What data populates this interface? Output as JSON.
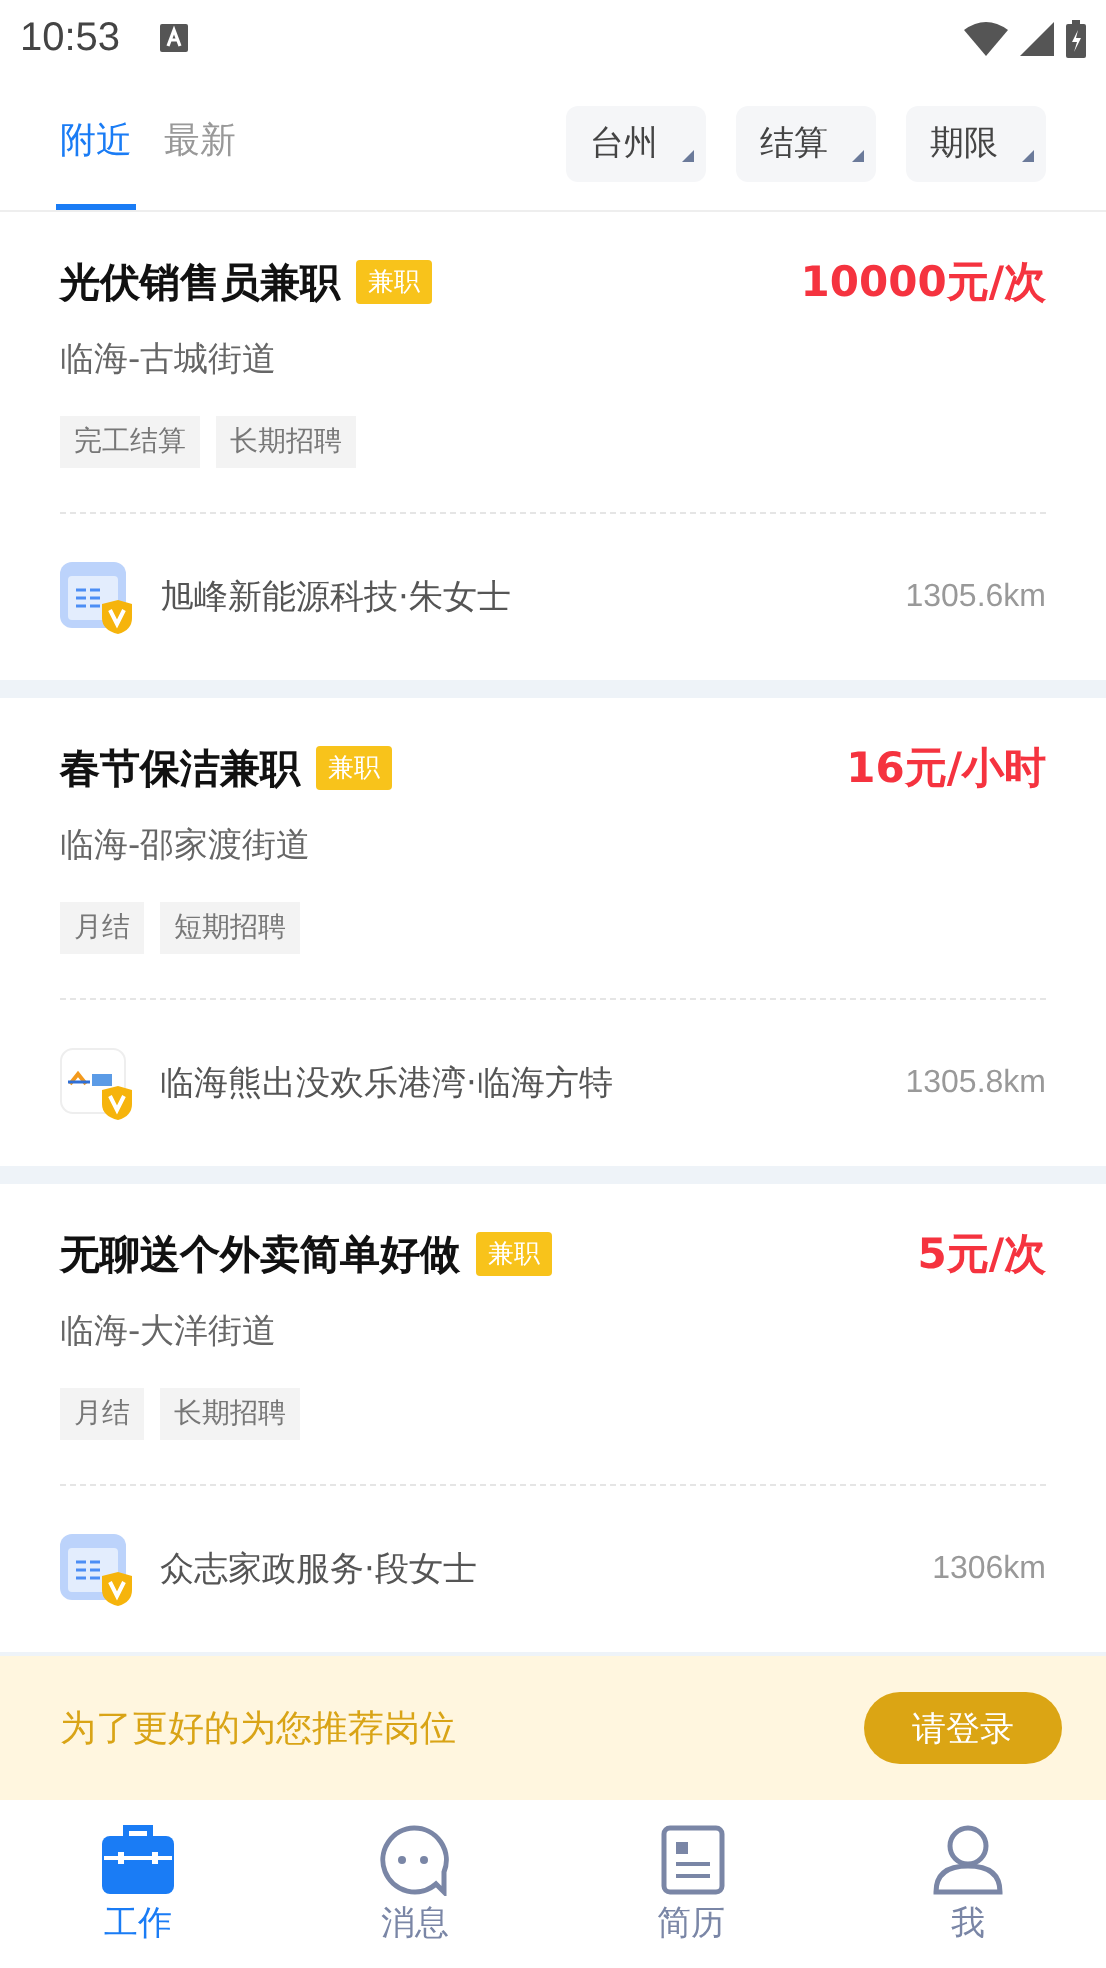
{
  "status_bar": {
    "time": "10:53"
  },
  "tabs": [
    {
      "label": "附近",
      "selected": true
    },
    {
      "label": "最新",
      "selected": false
    }
  ],
  "filters": [
    {
      "label": "台州"
    },
    {
      "label": "结算"
    },
    {
      "label": "期限"
    }
  ],
  "jobs": [
    {
      "title": "光伏销售员兼职",
      "badge": "兼职",
      "pay": "10000元/次",
      "location": "临海-古城街道",
      "tags": [
        "完工结算",
        "长期招聘"
      ],
      "company": "旭峰新能源科技·朱女士",
      "kind": "document",
      "distance": "1305.6km"
    },
    {
      "title": "春节保洁兼职",
      "badge": "兼职",
      "pay": "16元/小时",
      "location": "临海-邵家渡街道",
      "tags": [
        "月结",
        "短期招聘"
      ],
      "company": "临海熊出没欢乐港湾·临海方特",
      "kind": "brand",
      "distance": "1305.8km"
    },
    {
      "title": "无聊送个外卖简单好做",
      "badge": "兼职",
      "pay": "5元/次",
      "location": "临海-大洋街道",
      "tags": [
        "月结",
        "长期招聘"
      ],
      "company": "众志家政服务·段女士",
      "kind": "document",
      "distance": "1306km"
    }
  ],
  "login_banner": {
    "message": "为了更好的为您推荐岗位",
    "button": "请登录"
  },
  "bottom_nav": [
    {
      "label": "工作",
      "selected": true
    },
    {
      "label": "消息",
      "selected": false
    },
    {
      "label": "简历",
      "selected": false
    },
    {
      "label": "我",
      "selected": false
    }
  ]
}
